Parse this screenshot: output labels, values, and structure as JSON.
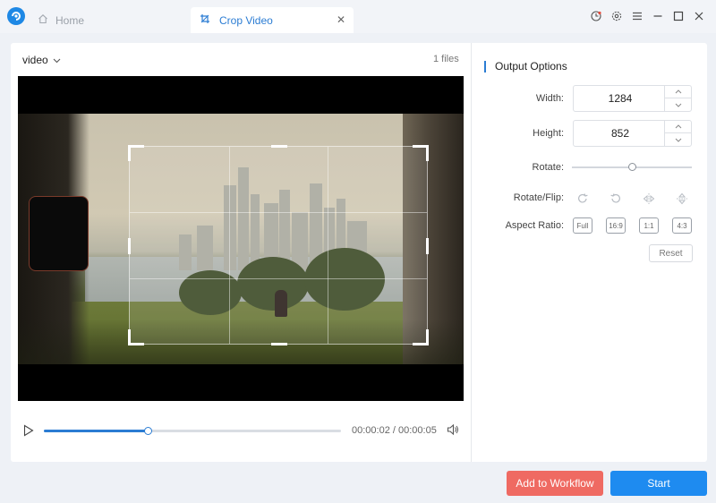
{
  "tabs": {
    "home_label": "Home",
    "crop_label": "Crop Video",
    "close_symbol": "✕"
  },
  "icons": {
    "logo": "app-logo-icon",
    "home": "home-icon",
    "crop": "crop-icon",
    "history": "clock-icon",
    "settings": "gear-icon",
    "menu": "hamburger-menu-icon",
    "minimize": "minimize-icon",
    "maximize": "maximize-icon",
    "close": "close-icon"
  },
  "video": {
    "select_label": "video",
    "files_count": "1 files",
    "current_time": "00:00:02",
    "total_time": "00:00:05",
    "time_separator": " / ",
    "progress": 0.35
  },
  "options": {
    "title": "Output Options",
    "width_label": "Width:",
    "width_value": "1284",
    "height_label": "Height:",
    "height_value": "852",
    "rotate_label": "Rotate:",
    "rotate_value": 0.5,
    "rotate_flip_label": "Rotate/Flip:",
    "aspect_ratio_label": "Aspect Ratio:",
    "ratios": [
      "Full",
      "16:9",
      "1:1",
      "4:3"
    ],
    "reset_label": "Reset"
  },
  "actions": {
    "workflow_label": "Add to Workflow",
    "start_label": "Start"
  },
  "colors": {
    "accent": "#2b7cd3",
    "workflow": "#ef6a62",
    "start": "#1e8bf0"
  }
}
